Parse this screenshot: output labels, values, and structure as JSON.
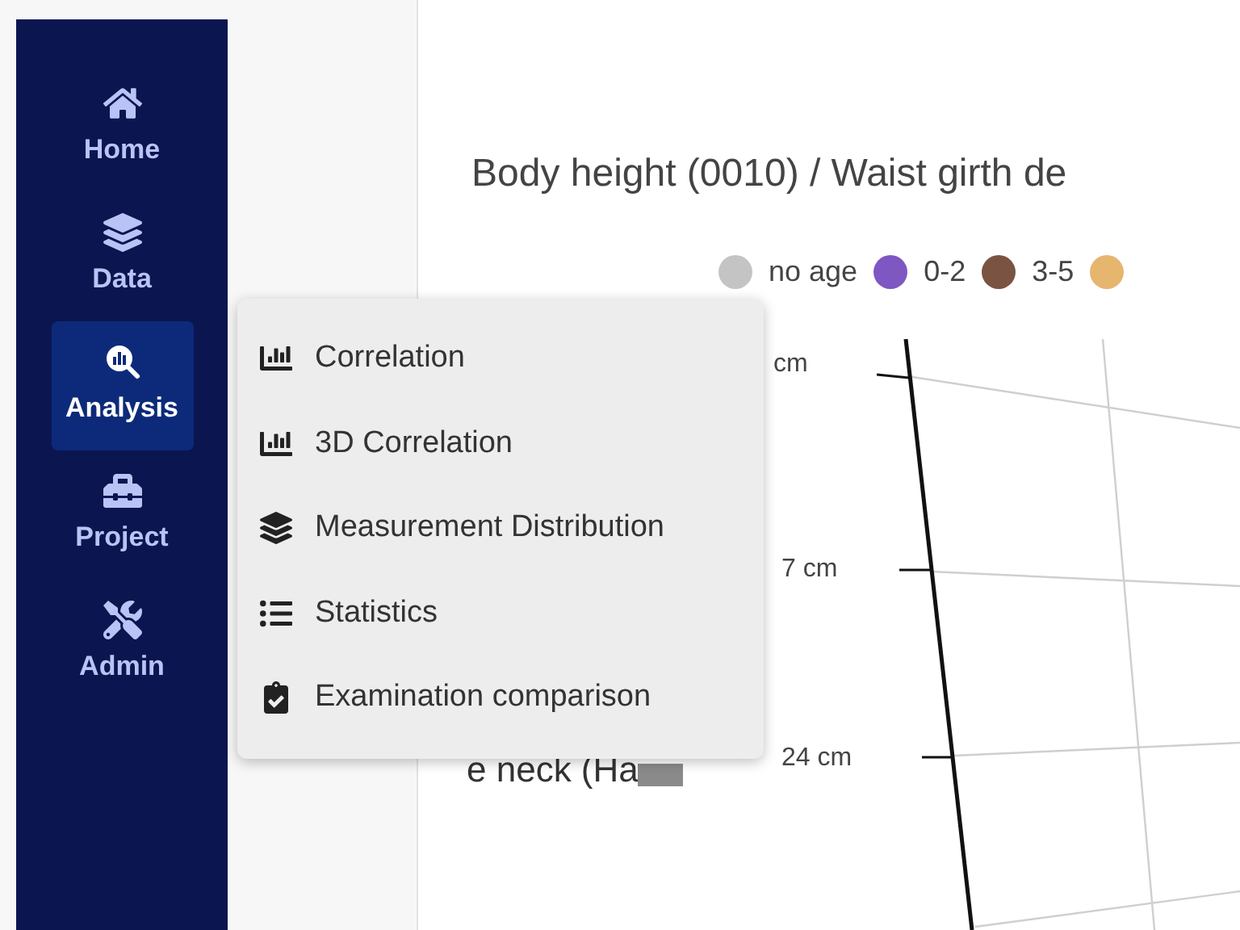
{
  "sidebar": {
    "items": [
      {
        "label": "Home",
        "selected": false
      },
      {
        "label": "Data",
        "selected": false
      },
      {
        "label": "Analysis",
        "selected": true
      },
      {
        "label": "Project",
        "selected": false
      },
      {
        "label": "Admin",
        "selected": false
      }
    ]
  },
  "chart": {
    "title": "Body height (0010) / Waist girth de",
    "legend": [
      {
        "label": "no age",
        "color": "#c4c4c4"
      },
      {
        "label": "0-2",
        "color": "#7e57c2"
      },
      {
        "label": "3-5",
        "color": "#7a5343"
      },
      {
        "color": "#e6b56e"
      }
    ],
    "tick_labels": [
      "cm",
      "7 cm",
      "24 cm"
    ],
    "axis_title": "e neck (Ha"
  },
  "analysis_menu": {
    "items": [
      {
        "label": "Correlation"
      },
      {
        "label": "3D Correlation"
      },
      {
        "label": "Measurement Distribution"
      },
      {
        "label": "Statistics"
      },
      {
        "label": "Examination comparison"
      }
    ]
  }
}
